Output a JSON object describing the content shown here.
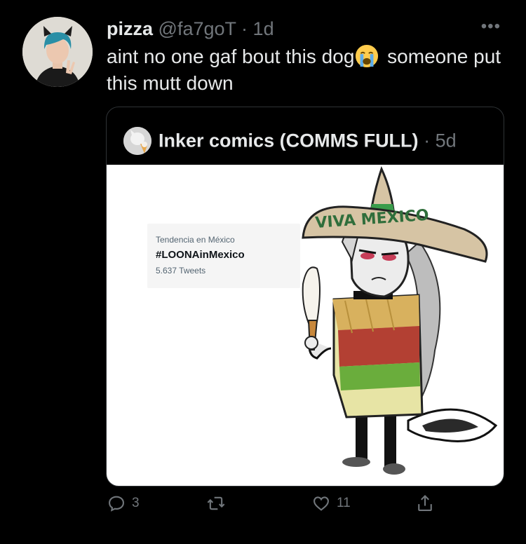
{
  "tweet": {
    "author_name": "pizza",
    "handle": "@fa7goT",
    "separator": "·",
    "time": "1d",
    "more_icon": "more-horizontal-icon",
    "text_before_emoji": "aint no one gaf bout this dog",
    "emoji": "loudly-crying-face",
    "text_after_emoji": " someone put this mutt down"
  },
  "quote": {
    "author_name": "Inker comics (COMMS FULL)",
    "separator": "·",
    "time": "5d",
    "image": {
      "trend_label": "Tendencia en México",
      "trend_tag": "#LOONAinMexico",
      "trend_count": "5.637 Tweets",
      "sombrero_text": "VIVA MEXICO"
    }
  },
  "actions": {
    "reply": {
      "icon": "reply-icon",
      "count": "3"
    },
    "retweet": {
      "icon": "retweet-icon",
      "count": ""
    },
    "like": {
      "icon": "heart-icon",
      "count": "11"
    },
    "share": {
      "icon": "share-icon",
      "count": ""
    }
  },
  "colors": {
    "background": "#000000",
    "text": "#e7e9ea",
    "secondary": "#71767b",
    "border": "#2f3336"
  }
}
